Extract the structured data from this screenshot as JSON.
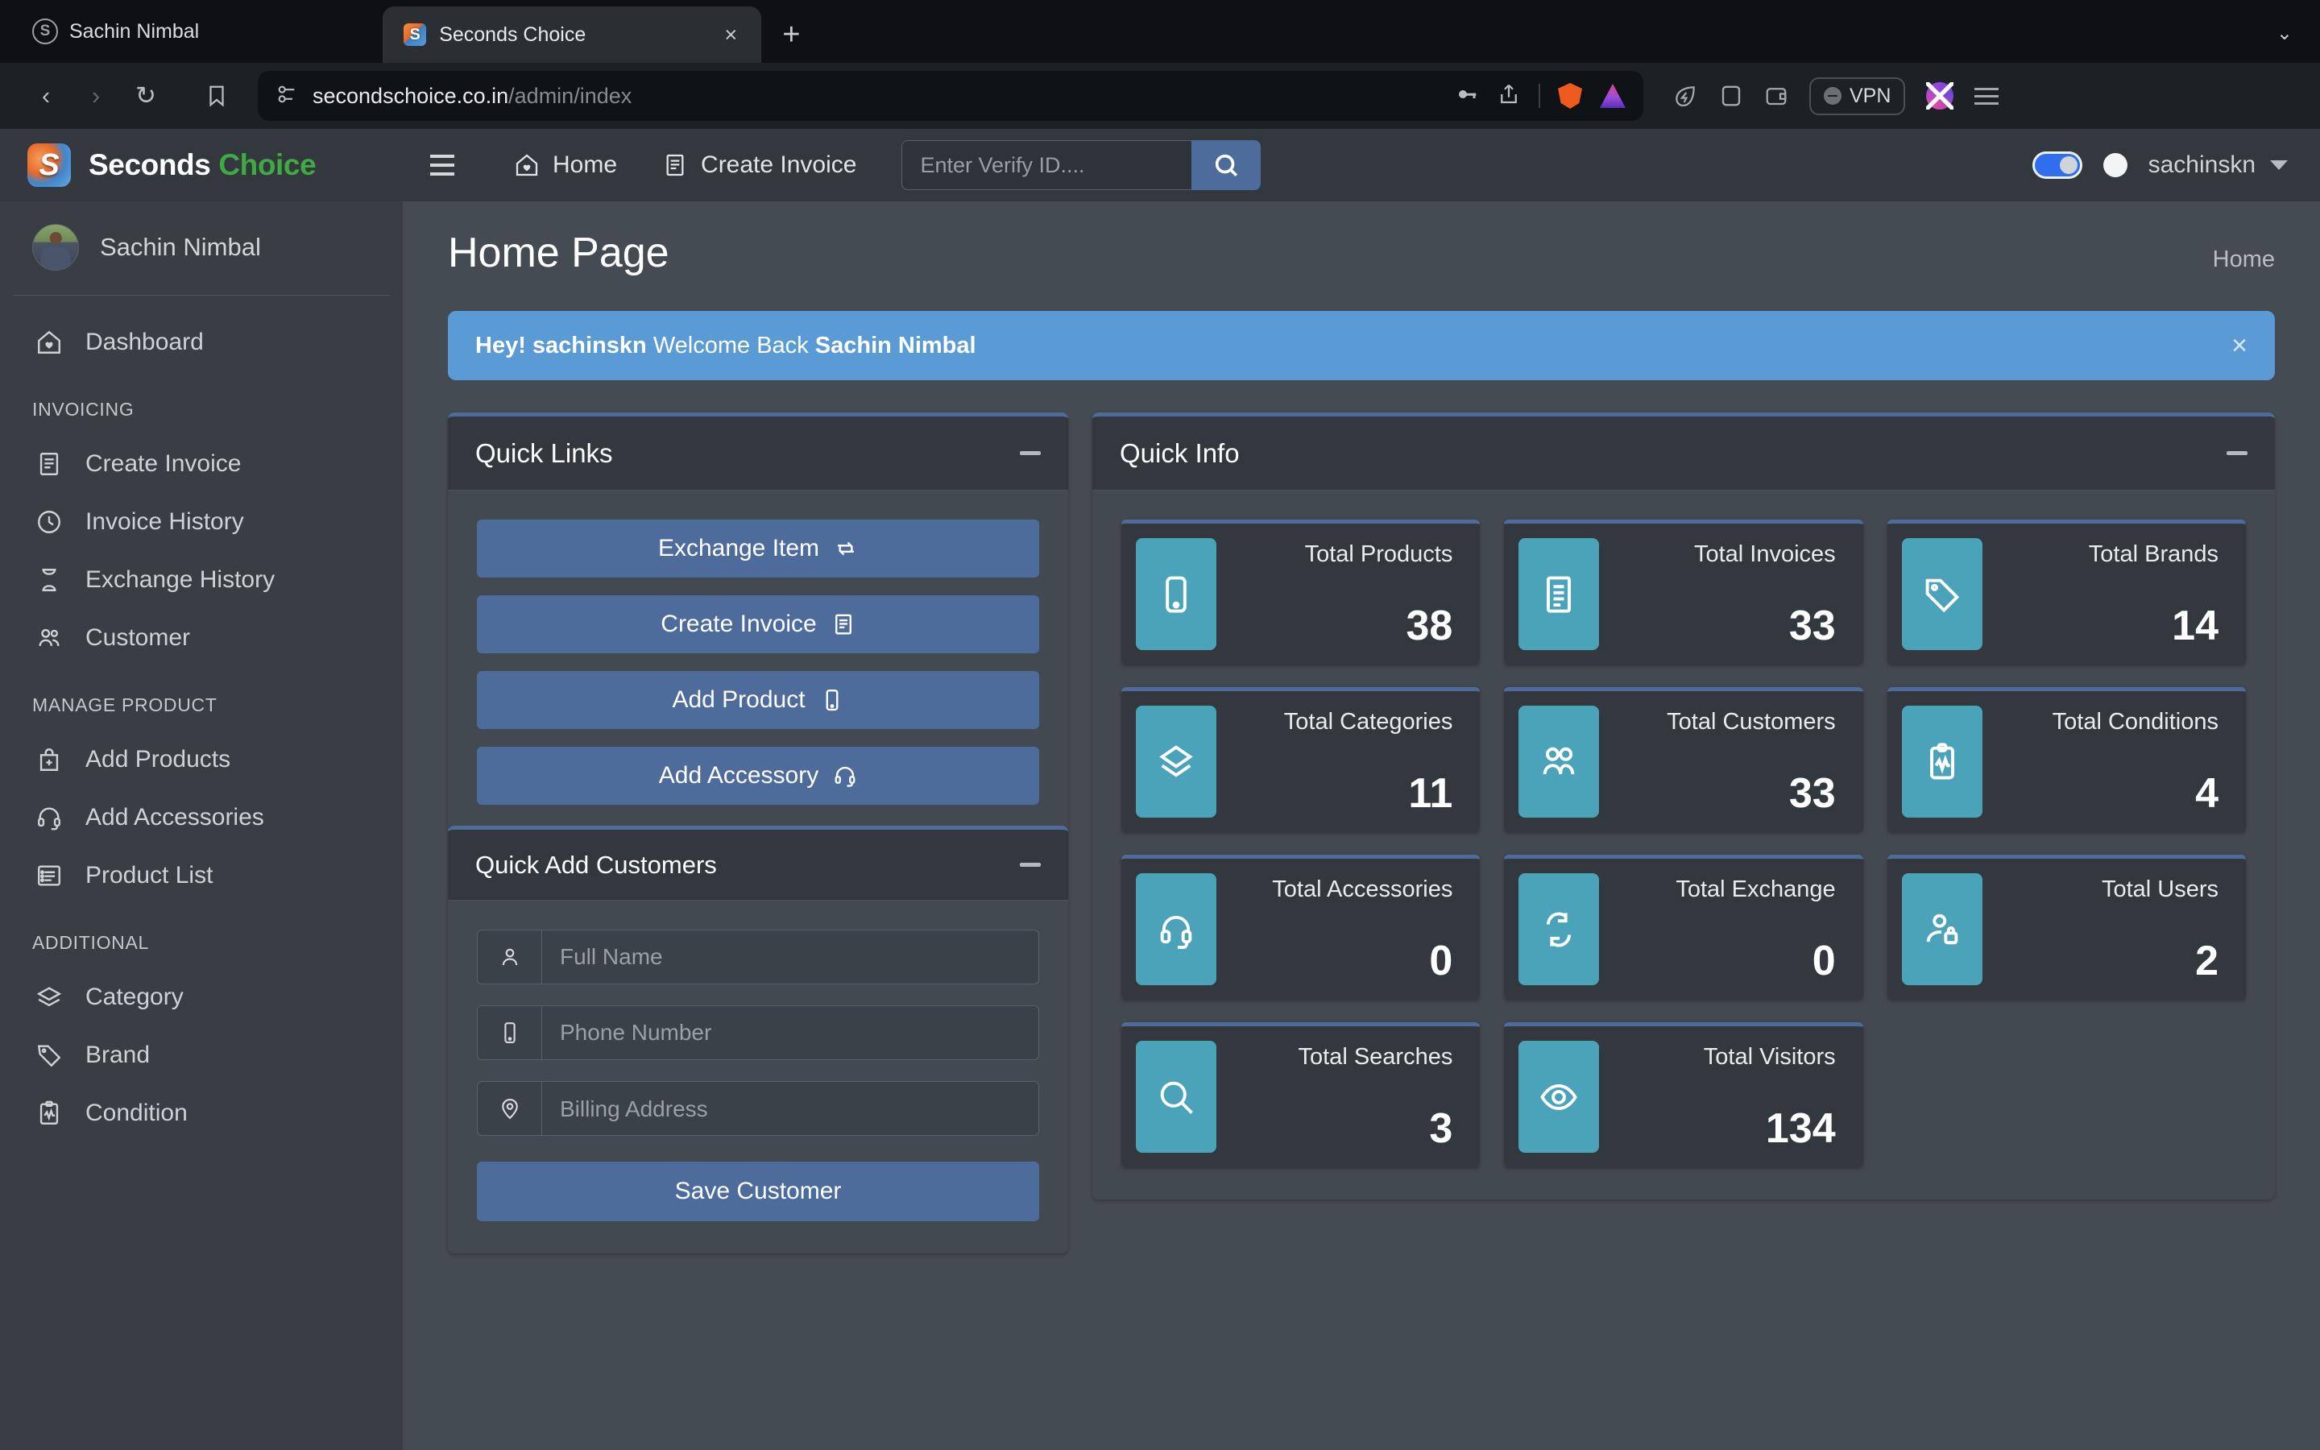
{
  "browser": {
    "profile_name": "Sachin Nimbal",
    "tab_title": "Seconds Choice",
    "tab_close_label": "×",
    "new_tab_label": "+",
    "url_domain": "secondschoice.co.in",
    "url_path": "/admin/index",
    "vpn_label": "VPN",
    "nav_back": "‹",
    "nav_forward": "›",
    "nav_reload": "↻",
    "tablist_chevron": "⌄"
  },
  "brand": {
    "word1": "Seconds",
    "word2": "Choice"
  },
  "sidebar": {
    "user_name": "Sachin Nimbal",
    "dashboard": {
      "label": "Dashboard",
      "icon": "home-heart-icon"
    },
    "sections": [
      {
        "title": "INVOICING",
        "items": [
          {
            "label": "Create Invoice",
            "icon": "invoice-icon"
          },
          {
            "label": "Invoice History",
            "icon": "clock-icon"
          },
          {
            "label": "Exchange History",
            "icon": "hourglass-icon"
          },
          {
            "label": "Customer",
            "icon": "users-icon"
          }
        ]
      },
      {
        "title": "MANAGE PRODUCT",
        "items": [
          {
            "label": "Add Products",
            "icon": "bag-plus-icon"
          },
          {
            "label": "Add Accessories",
            "icon": "headset-icon"
          },
          {
            "label": "Product List",
            "icon": "list-icon"
          }
        ]
      },
      {
        "title": "ADDITIONAL",
        "items": [
          {
            "label": "Category",
            "icon": "layers-icon"
          },
          {
            "label": "Brand",
            "icon": "tag-icon"
          },
          {
            "label": "Condition",
            "icon": "clipboard-pulse-icon"
          }
        ]
      }
    ]
  },
  "topnav": {
    "home_label": "Home",
    "create_invoice_label": "Create Invoice",
    "verify_placeholder": "Enter Verify ID....",
    "verify_value": "",
    "username": "sachinskn",
    "dark_mode_on": true
  },
  "page": {
    "title": "Home Page",
    "breadcrumb": "Home",
    "alert": {
      "greeting": "Hey! sachinskn",
      "middle": " Welcome Back ",
      "name": "Sachin Nimbal",
      "dismiss": "×"
    }
  },
  "quick_links": {
    "title": "Quick Links",
    "buttons": [
      {
        "label": "Exchange Item",
        "icon": "exchange-icon"
      },
      {
        "label": "Create Invoice",
        "icon": "invoice-icon"
      },
      {
        "label": "Add Product",
        "icon": "phone-icon"
      },
      {
        "label": "Add Accessory",
        "icon": "headset-icon"
      }
    ]
  },
  "quick_add_customers": {
    "title": "Quick Add Customers",
    "fields": [
      {
        "placeholder": "Full Name",
        "value": "",
        "icon": "person-icon"
      },
      {
        "placeholder": "Phone Number",
        "value": "",
        "icon": "phone-icon"
      },
      {
        "placeholder": "Billing Address",
        "value": "",
        "icon": "map-pin-icon"
      }
    ],
    "save_label": "Save Customer"
  },
  "quick_info": {
    "title": "Quick Info",
    "cards": [
      {
        "label": "Total Products",
        "value": "38",
        "icon": "phone-icon"
      },
      {
        "label": "Total Invoices",
        "value": "33",
        "icon": "invoice-icon"
      },
      {
        "label": "Total Brands",
        "value": "14",
        "icon": "tag-icon"
      },
      {
        "label": "Total Categories",
        "value": "11",
        "icon": "layers-icon"
      },
      {
        "label": "Total Customers",
        "value": "33",
        "icon": "users-icon"
      },
      {
        "label": "Total Conditions",
        "value": "4",
        "icon": "clipboard-pulse-icon"
      },
      {
        "label": "Total Accessories",
        "value": "0",
        "icon": "headset-icon"
      },
      {
        "label": "Total Exchange",
        "value": "0",
        "icon": "exchange-icon"
      },
      {
        "label": "Total Users",
        "value": "2",
        "icon": "user-lock-icon"
      },
      {
        "label": "Total Searches",
        "value": "3",
        "icon": "search-icon"
      },
      {
        "label": "Total Visitors",
        "value": "134",
        "icon": "eye-icon"
      }
    ]
  },
  "colors": {
    "accent_blue": "#4d6c9b",
    "accent_teal": "#4aa3b8",
    "alert_blue": "#5b9bd5",
    "brand_green": "#3faa42",
    "panel_bg": "#434950",
    "panel_head_bg": "#33383e",
    "content_bg": "#454b52",
    "sidebar_bg": "#383e44",
    "toggle_on": "#2f6fed"
  }
}
